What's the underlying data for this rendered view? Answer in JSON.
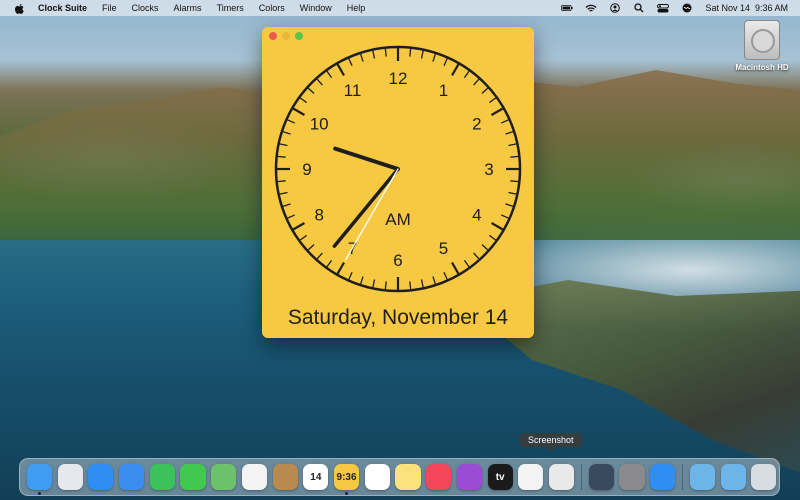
{
  "menubar": {
    "app_name": "Clock Suite",
    "menus": [
      "File",
      "Clocks",
      "Alarms",
      "Timers",
      "Colors",
      "Window",
      "Help"
    ],
    "datetime": "Sat Nov 14  9:36 AM"
  },
  "desktop": {
    "hd_label": "Macintosh HD"
  },
  "clock_window": {
    "numerals": [
      "12",
      "1",
      "2",
      "3",
      "4",
      "5",
      "6",
      "7",
      "8",
      "9",
      "10",
      "11"
    ],
    "ampm": "AM",
    "date_text": "Saturday, November 14",
    "colors": {
      "face": "#f7c842",
      "hands": "#1e1e1e",
      "second_hand": "#ffffff"
    },
    "time": {
      "hour": 9,
      "minute": 36,
      "second": 35
    }
  },
  "tooltip": "Screenshot",
  "dock": {
    "items": [
      {
        "name": "finder-icon",
        "color": "#3f9cf0",
        "label": ""
      },
      {
        "name": "launchpad-icon",
        "color": "#e7e7ee",
        "label": ""
      },
      {
        "name": "safari-icon",
        "color": "#2f8ef2",
        "label": ""
      },
      {
        "name": "mail-icon",
        "color": "#3c8df1",
        "label": ""
      },
      {
        "name": "facetime-icon",
        "color": "#3cc25a",
        "label": ""
      },
      {
        "name": "messages-icon",
        "color": "#40c84f",
        "label": ""
      },
      {
        "name": "maps-icon",
        "color": "#6bc26a",
        "label": ""
      },
      {
        "name": "photos-icon",
        "color": "#f3f3f3",
        "label": ""
      },
      {
        "name": "contacts-icon",
        "color": "#b98a4e",
        "label": ""
      },
      {
        "name": "calendar-icon",
        "color": "#ffffff",
        "label": "14"
      },
      {
        "name": "clock-suite-icon",
        "color": "#f7c842",
        "label": "9:36"
      },
      {
        "name": "reminders-icon",
        "color": "#ffffff",
        "label": ""
      },
      {
        "name": "notes-icon",
        "color": "#fbe27a",
        "label": ""
      },
      {
        "name": "music-icon",
        "color": "#f5465a",
        "label": ""
      },
      {
        "name": "podcasts-icon",
        "color": "#9a4cd6",
        "label": ""
      },
      {
        "name": "tv-icon",
        "color": "#1a1a1a",
        "label": "tv"
      },
      {
        "name": "news-icon",
        "color": "#f3f3f3",
        "label": ""
      },
      {
        "name": "screenshot-icon",
        "color": "#e9e9e9",
        "label": ""
      },
      {
        "name": "quicktime-icon",
        "color": "#3a4a5e",
        "label": ""
      },
      {
        "name": "system-preferences-icon",
        "color": "#8a8a8e",
        "label": ""
      },
      {
        "name": "app-store-icon",
        "color": "#2f8ef2",
        "label": ""
      },
      {
        "name": "applications-folder-icon",
        "color": "#6db5e8",
        "label": ""
      },
      {
        "name": "downloads-folder-icon",
        "color": "#6db5e8",
        "label": ""
      },
      {
        "name": "trash-icon",
        "color": "#d7dde2",
        "label": ""
      }
    ]
  }
}
